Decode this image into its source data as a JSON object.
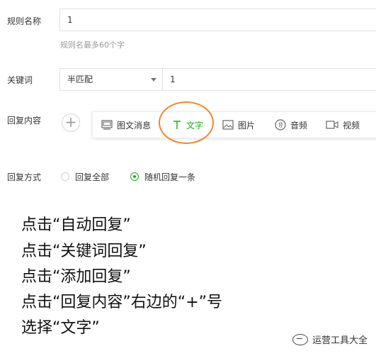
{
  "form": {
    "rule_name_label": "规则名称",
    "rule_name_value": "1",
    "rule_name_hint": "规则名最多60个字",
    "keyword_label": "关键词",
    "keyword_match_value": "半匹配",
    "keyword_value": "1",
    "reply_content_label": "回复内容",
    "add_icon": "plus-icon",
    "reply_mode_label": "回复方式",
    "reply_options": [
      {
        "label": "回复全部",
        "selected": false
      },
      {
        "label": "随机回复一条",
        "selected": true
      }
    ]
  },
  "toolbar": {
    "items": [
      {
        "label": "图文消息",
        "icon": "news-icon",
        "active": false
      },
      {
        "label": "文字",
        "icon": "text-icon",
        "active": true
      },
      {
        "label": "图片",
        "icon": "image-icon",
        "active": false
      },
      {
        "label": "音频",
        "icon": "audio-icon",
        "active": false
      },
      {
        "label": "视频",
        "icon": "video-icon",
        "active": false
      }
    ]
  },
  "instructions": [
    "点击“自动回复”",
    "点击“关键词回复”",
    "点击“添加回复”",
    "点击“回复内容”右边的“+”号",
    "选择“文字”"
  ],
  "watermark": "运营工具大全",
  "colors": {
    "accent": "#1aad19",
    "highlight": "#f0882a"
  }
}
